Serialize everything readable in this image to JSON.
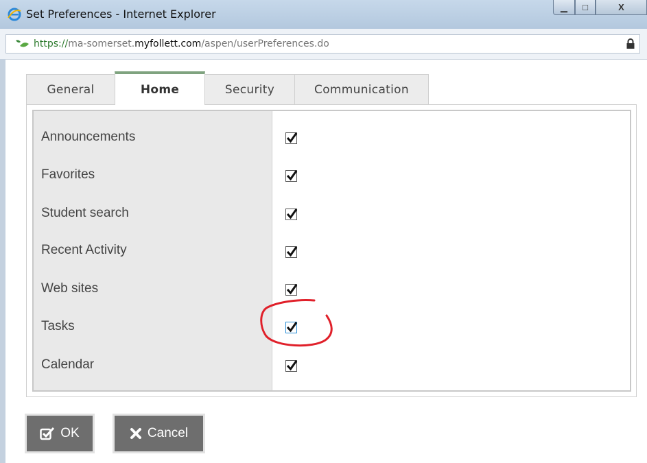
{
  "window": {
    "title": "Set Preferences - Internet Explorer",
    "controls": {
      "minimize": "▁",
      "maximize": "□",
      "close": "X"
    }
  },
  "address_bar": {
    "scheme": "https://",
    "subdomain": "ma-somerset.",
    "domain": "myfollett.com",
    "path": "/aspen/userPreferences.do"
  },
  "tabs": [
    {
      "label": "General",
      "active": false
    },
    {
      "label": "Home",
      "active": true
    },
    {
      "label": "Security",
      "active": false
    },
    {
      "label": "Communication",
      "active": false
    }
  ],
  "preferences": [
    {
      "label": "Announcements",
      "checked": true
    },
    {
      "label": "Favorites",
      "checked": true
    },
    {
      "label": "Student search",
      "checked": true
    },
    {
      "label": "Recent Activity",
      "checked": true
    },
    {
      "label": "Web sites",
      "checked": true
    },
    {
      "label": "Tasks",
      "checked": true,
      "focused": true
    },
    {
      "label": "Calendar",
      "checked": true
    }
  ],
  "buttons": {
    "ok": "OK",
    "cancel": "Cancel"
  },
  "colors": {
    "active_tab_accent": "#7fa37f",
    "button_bg": "#6e6e6e",
    "annotation": "#e0202a"
  }
}
